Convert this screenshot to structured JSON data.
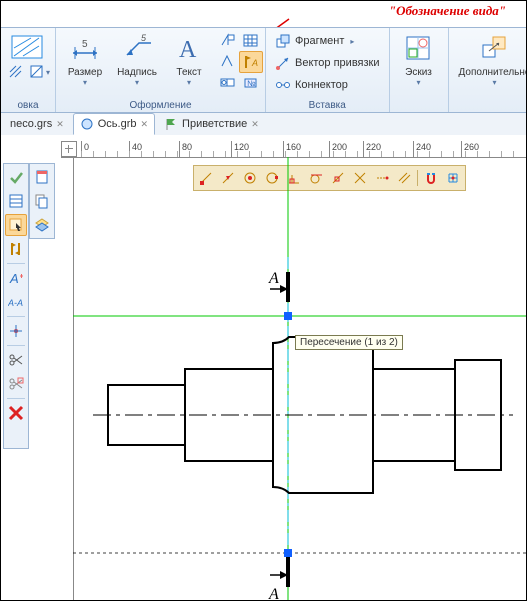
{
  "callout": "\"Обозначение вида\"",
  "ribbon": {
    "hatch_label": "овка",
    "size_label": "Размер",
    "note_label": "Надпись",
    "text_label": "Текст",
    "group_format": "Оформление",
    "fragment_label": "Фрагмент",
    "vector_label": "Вектор привязки",
    "connector_label": "Коннектор",
    "group_insert": "Вставка",
    "sketch_label": "Эскиз",
    "extra_label": "Дополнительно"
  },
  "tabs": {
    "t1": "neco.grs",
    "t2": "Ось.grb",
    "t3": "Приветствие"
  },
  "ruler": {
    "v0": "0",
    "v40": "40",
    "v80": "80",
    "v120": "120",
    "v160": "160",
    "v200": "200",
    "v220": "220",
    "v240": "240",
    "v260": "260"
  },
  "tooltip": "Пересечение (1 из 2)",
  "section_letter": "А",
  "icons": {
    "dimension": "dimension-icon",
    "note": "note-icon",
    "text": "text-icon",
    "fragment": "fragment-icon",
    "vector": "vector-icon",
    "connector": "connector-icon",
    "sketch": "sketch-icon",
    "extra": "extra-icon",
    "view_designation": "view-designation-icon"
  },
  "colors": {
    "accent": "#e6a23c",
    "ribbon_bg": "#e4edf7",
    "construction": "#00c800",
    "axis": "#00bcd4"
  }
}
